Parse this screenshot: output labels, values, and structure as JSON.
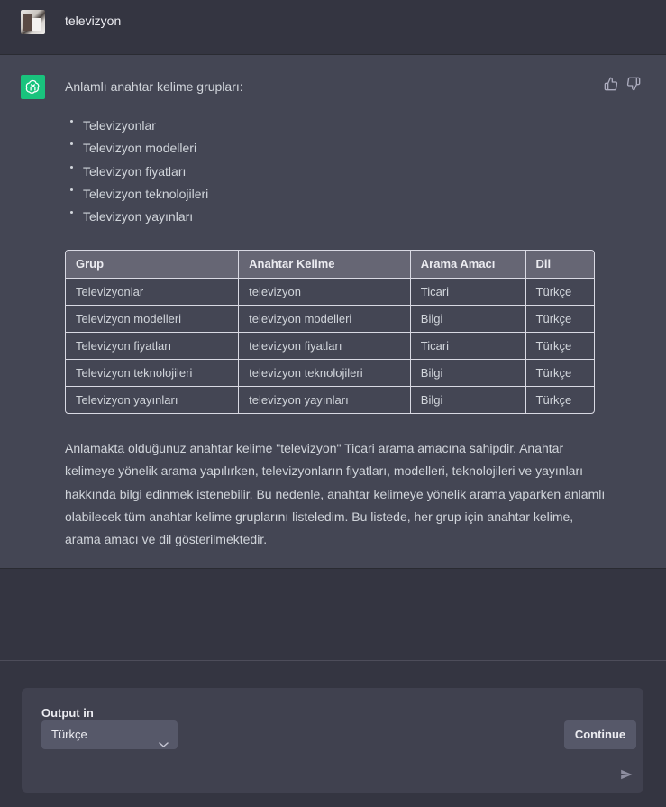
{
  "user_message": {
    "text": "televizyon"
  },
  "assistant": {
    "intro": "Anlamlı anahtar kelime grupları:",
    "bullets": [
      "Televizyonlar",
      "Televizyon modelleri",
      "Televizyon fiyatları",
      "Televizyon teknolojileri",
      "Televizyon yayınları"
    ],
    "table": {
      "headers": [
        "Grup",
        "Anahtar Kelime",
        "Arama Amacı",
        "Dil"
      ],
      "rows": [
        [
          "Televizyonlar",
          "televizyon",
          "Ticari",
          "Türkçe"
        ],
        [
          "Televizyon modelleri",
          "televizyon modelleri",
          "Bilgi",
          "Türkçe"
        ],
        [
          "Televizyon fiyatları",
          "televizyon fiyatları",
          "Ticari",
          "Türkçe"
        ],
        [
          "Televizyon teknolojileri",
          "televizyon teknolojileri",
          "Bilgi",
          "Türkçe"
        ],
        [
          "Televizyon yayınları",
          "televizyon yayınları",
          "Bilgi",
          "Türkçe"
        ]
      ]
    },
    "paragraph": "Anlamakta olduğunuz anahtar kelime \"televizyon\" Ticari arama amacına sahipdir. Anahtar kelimeye yönelik arama yapılırken, televizyonların fiyatları, modelleri, teknolojileri ve yayınları hakkında bilgi edinmek istenebilir. Bu nedenle, anahtar kelimeye yönelik arama yaparken anlamlı olabilecek tüm anahtar kelime gruplarını listeledim. Bu listede, her grup için anahtar kelime, arama amacı ve dil gösterilmektedir."
  },
  "composer": {
    "output_label": "Output in",
    "language_selected": "Türkçe",
    "continue_label": "Continue"
  },
  "icons": {
    "gpt_avatar": "openai-logo-icon",
    "thumbs_up": "thumbs-up-icon",
    "thumbs_down": "thumbs-down-icon",
    "chevron": "chevron-down-icon",
    "send": "send-icon"
  },
  "colors": {
    "page_bg": "#343541",
    "assistant_bg": "#444654",
    "gpt_green": "#19c37d",
    "table_header_bg": "#666674"
  }
}
